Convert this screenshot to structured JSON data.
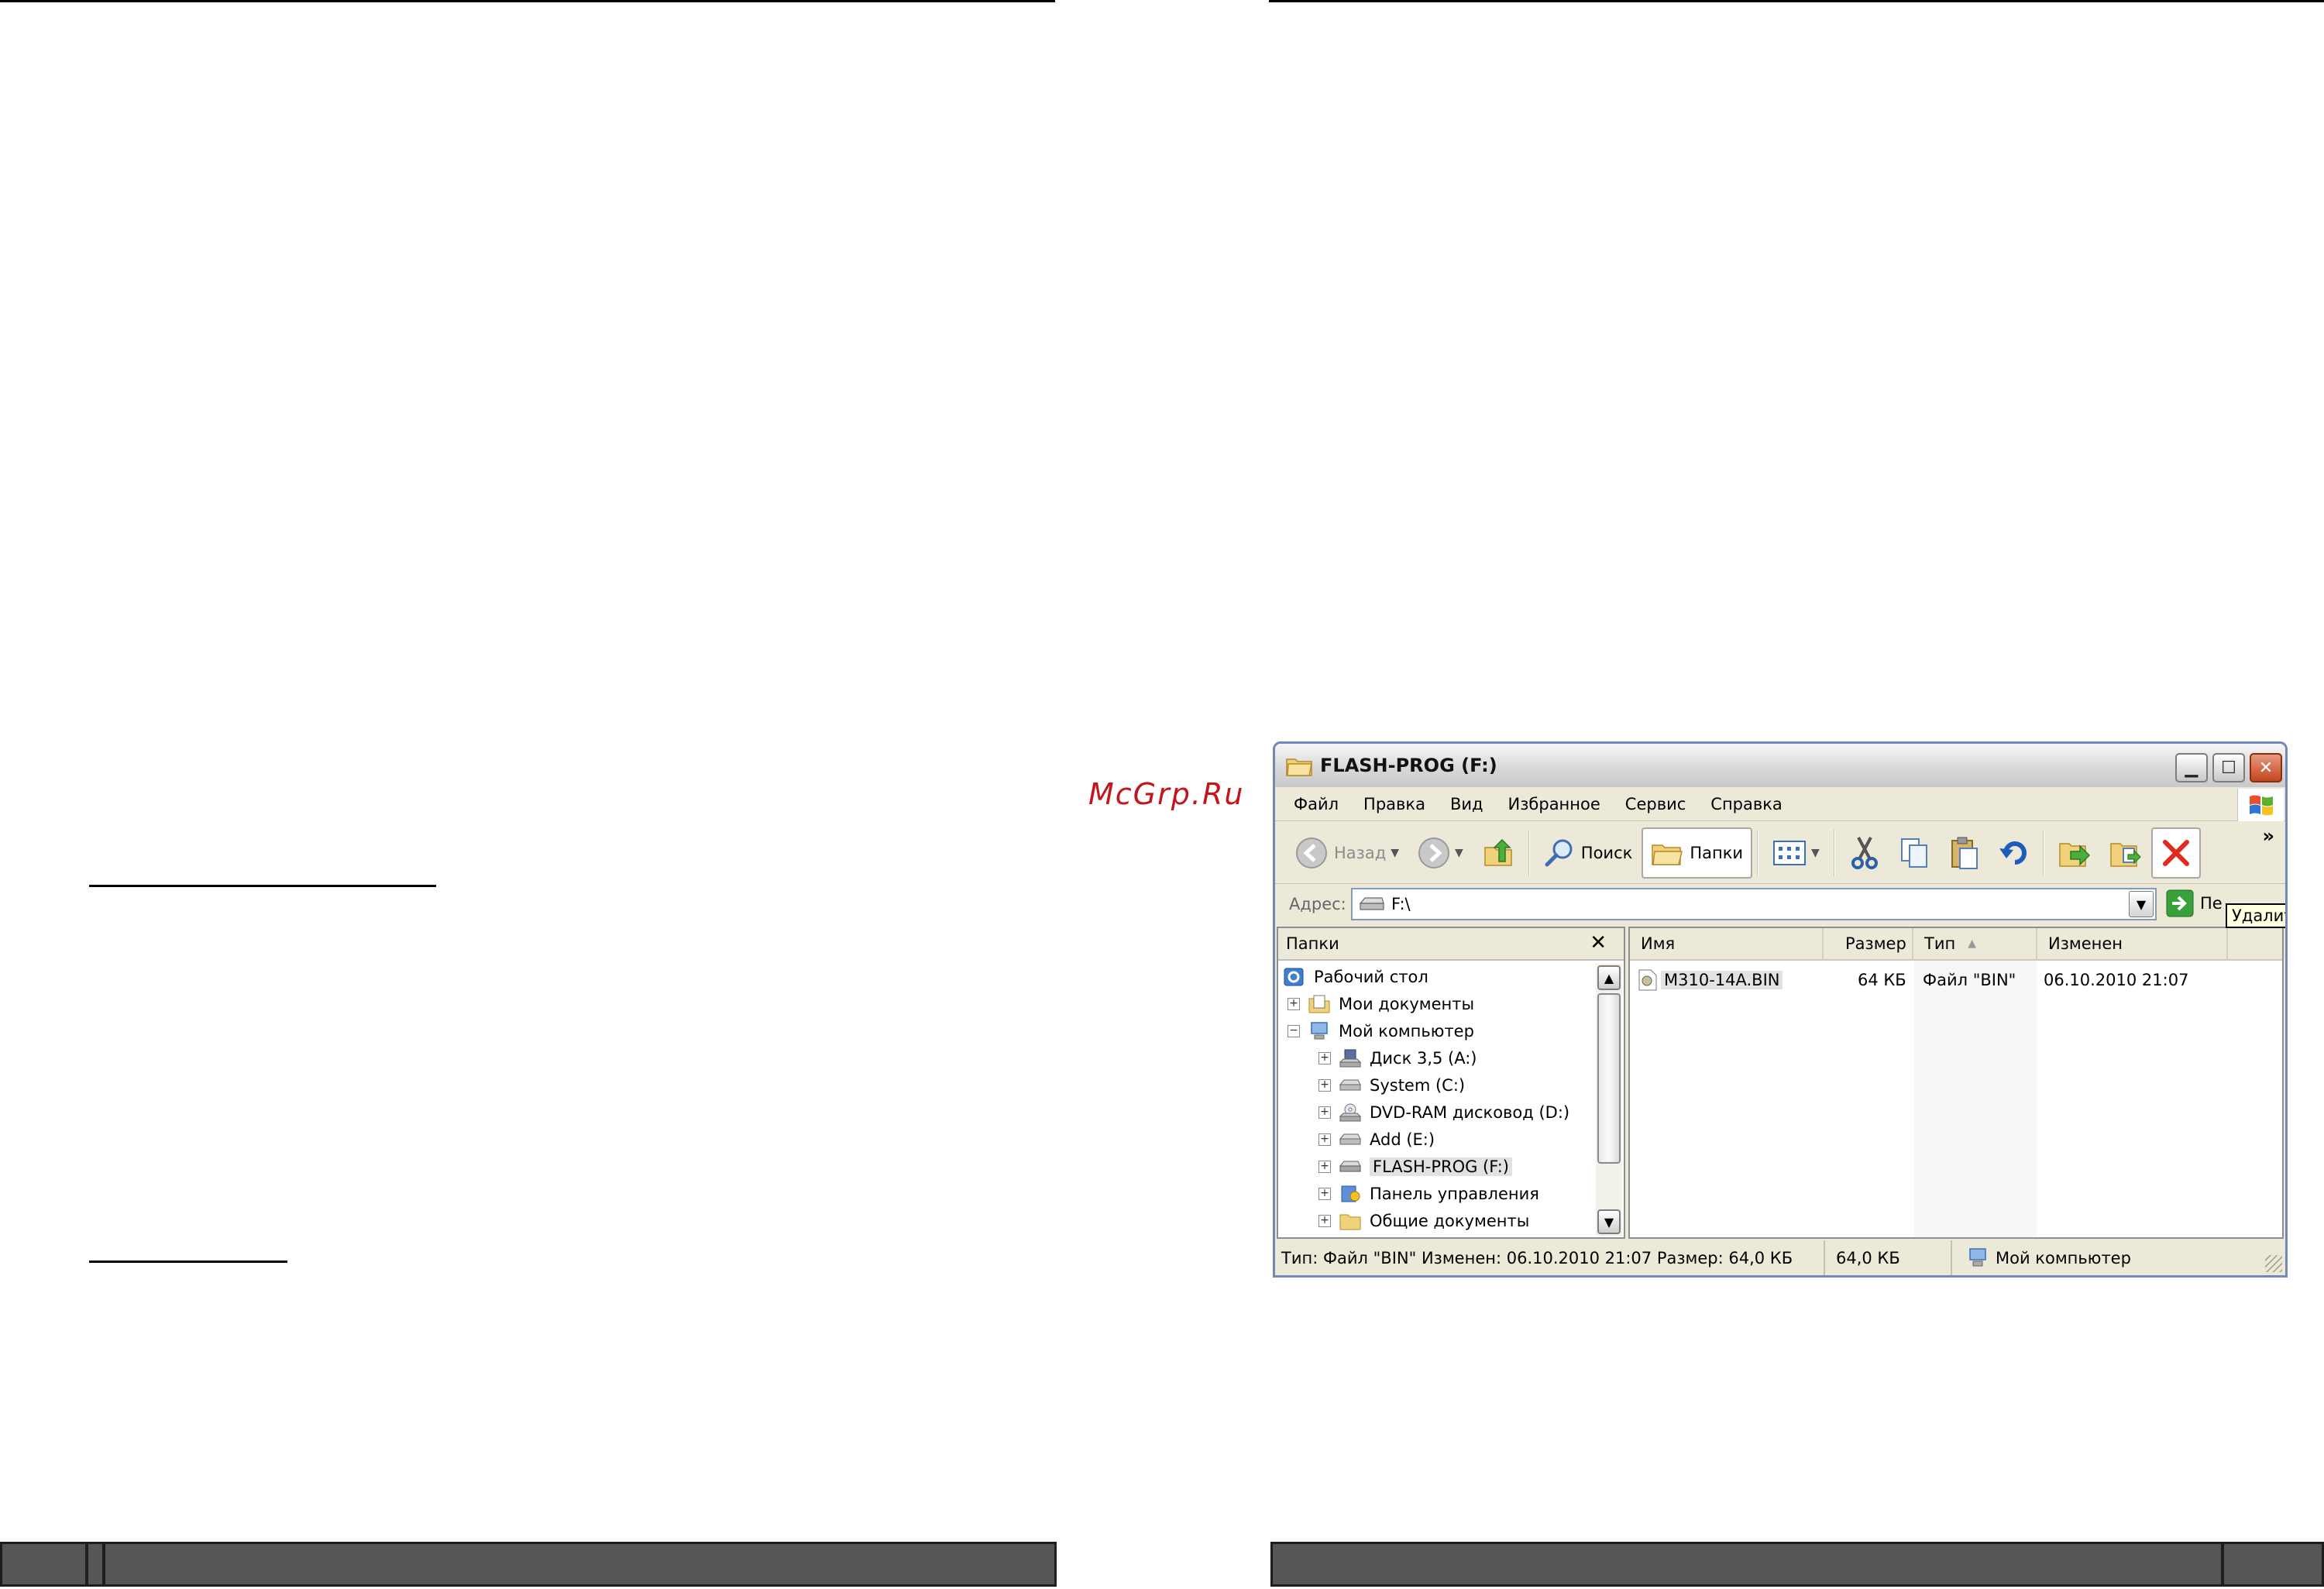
{
  "watermark": "McGrp.Ru",
  "explorer": {
    "title": "FLASH-PROG (F:)",
    "menu": [
      "Файл",
      "Правка",
      "Вид",
      "Избранное",
      "Сервис",
      "Справка"
    ],
    "toolbar": {
      "back": "Назад",
      "search": "Поиск",
      "folders": "Папки"
    },
    "address": {
      "label": "Адрес:",
      "value": "F:\\",
      "go": "Пе"
    },
    "tooltip": "Удалить",
    "folders_pane": {
      "title": "Папки",
      "items": [
        {
          "label": "Рабочий стол",
          "icon": "desktop-icon"
        },
        {
          "label": "Мои документы",
          "icon": "my-documents-icon"
        },
        {
          "label": "Мой компьютер",
          "icon": "my-computer-icon"
        },
        {
          "label": "Диск 3,5 (A:)",
          "icon": "floppy-drive-icon"
        },
        {
          "label": "System (C:)",
          "icon": "hard-drive-icon"
        },
        {
          "label": "DVD-RAM дисковод (D:)",
          "icon": "dvd-drive-icon"
        },
        {
          "label": "Add (E:)",
          "icon": "hard-drive-icon"
        },
        {
          "label": "FLASH-PROG (F:)",
          "icon": "removable-drive-icon"
        },
        {
          "label": "Панель управления",
          "icon": "control-panel-icon"
        },
        {
          "label": "Общие документы",
          "icon": "folder-icon"
        }
      ]
    },
    "columns": [
      "Имя",
      "Размер",
      "Тип",
      "Изменен"
    ],
    "files": [
      {
        "name": "M310-14A.BIN",
        "size": "64 КБ",
        "type": "Файл \"BIN\"",
        "modified": "06.10.2010 21:07"
      }
    ],
    "status": {
      "info": "Тип: Файл \"BIN\" Изменен: 06.10.2010 21:07 Размер: 64,0 КБ",
      "size": "64,0 КБ",
      "location": "Мой компьютер"
    }
  }
}
